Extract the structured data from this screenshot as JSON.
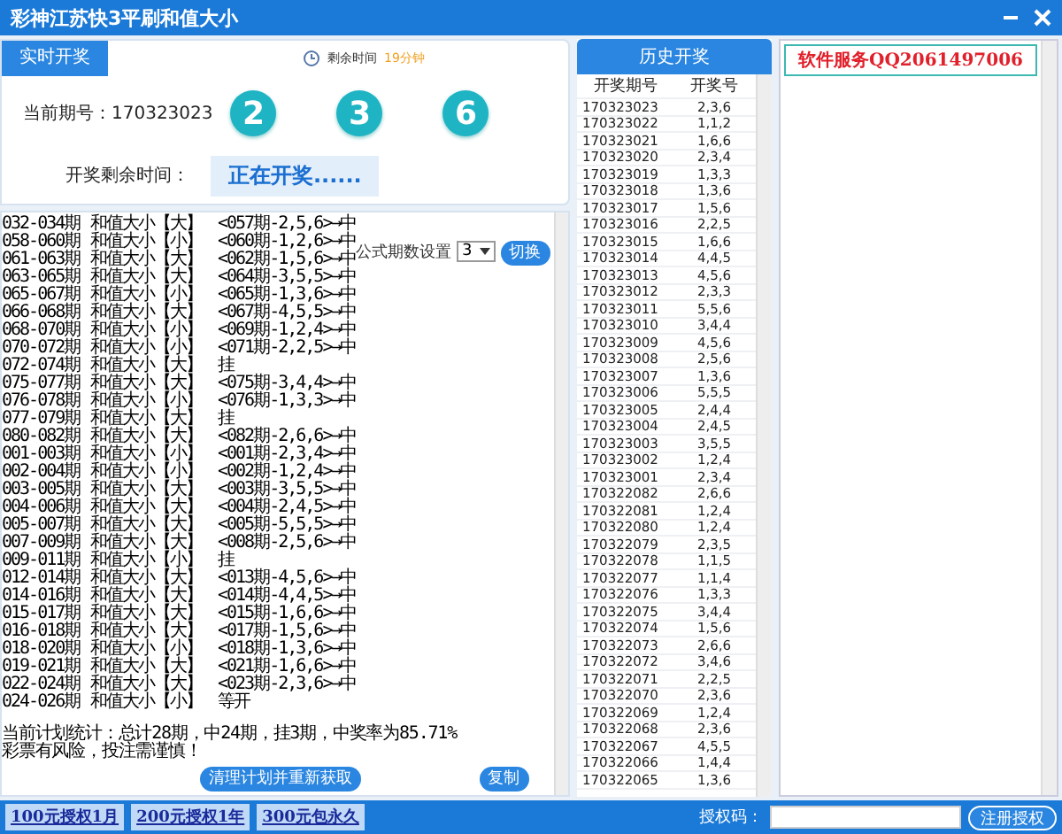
{
  "window": {
    "title": "彩神江苏快3平刷和值大小"
  },
  "live": {
    "tab": "实时开奖",
    "countdown_label": "剩余时间",
    "countdown_value": "19分钟",
    "period_label": "当前期号：",
    "period": "170323023",
    "balls": [
      "2",
      "3",
      "6"
    ],
    "remaining_label": "开奖剩余时间：",
    "status": "正在开奖......"
  },
  "plan": {
    "setting_label": "公式期数设置",
    "setting_value": "3",
    "switch_button": "切换",
    "log": [
      {
        "period": "032-034期",
        "plan": "和值大小【大】",
        "result": "<057期-2,5,6>→中"
      },
      {
        "period": "058-060期",
        "plan": "和值大小【小】",
        "result": "<060期-1,2,6>→中"
      },
      {
        "period": "061-063期",
        "plan": "和值大小【大】",
        "result": "<062期-1,5,6>→中"
      },
      {
        "period": "063-065期",
        "plan": "和值大小【大】",
        "result": "<064期-3,5,5>→中"
      },
      {
        "period": "065-067期",
        "plan": "和值大小【小】",
        "result": "<065期-1,3,6>→中"
      },
      {
        "period": "066-068期",
        "plan": "和值大小【大】",
        "result": "<067期-4,5,5>→中"
      },
      {
        "period": "068-070期",
        "plan": "和值大小【小】",
        "result": "<069期-1,2,4>→中"
      },
      {
        "period": "070-072期",
        "plan": "和值大小【小】",
        "result": "<071期-2,2,5>→中"
      },
      {
        "period": "072-074期",
        "plan": "和值大小【大】",
        "result": "挂"
      },
      {
        "period": "075-077期",
        "plan": "和值大小【大】",
        "result": "<075期-3,4,4>→中"
      },
      {
        "period": "076-078期",
        "plan": "和值大小【小】",
        "result": "<076期-1,3,3>→中"
      },
      {
        "period": "077-079期",
        "plan": "和值大小【大】",
        "result": "挂"
      },
      {
        "period": "080-082期",
        "plan": "和值大小【大】",
        "result": "<082期-2,6,6>→中"
      },
      {
        "period": "001-003期",
        "plan": "和值大小【小】",
        "result": "<001期-2,3,4>→中"
      },
      {
        "period": "002-004期",
        "plan": "和值大小【小】",
        "result": "<002期-1,2,4>→中"
      },
      {
        "period": "003-005期",
        "plan": "和值大小【大】",
        "result": "<003期-3,5,5>→中"
      },
      {
        "period": "004-006期",
        "plan": "和值大小【大】",
        "result": "<004期-2,4,5>→中"
      },
      {
        "period": "005-007期",
        "plan": "和值大小【大】",
        "result": "<005期-5,5,5>→中"
      },
      {
        "period": "007-009期",
        "plan": "和值大小【大】",
        "result": "<008期-2,5,6>→中"
      },
      {
        "period": "009-011期",
        "plan": "和值大小【小】",
        "result": "挂"
      },
      {
        "period": "012-014期",
        "plan": "和值大小【大】",
        "result": "<013期-4,5,6>→中"
      },
      {
        "period": "014-016期",
        "plan": "和值大小【大】",
        "result": "<014期-4,4,5>→中"
      },
      {
        "period": "015-017期",
        "plan": "和值大小【大】",
        "result": "<015期-1,6,6>→中"
      },
      {
        "period": "016-018期",
        "plan": "和值大小【大】",
        "result": "<017期-1,5,6>→中"
      },
      {
        "period": "018-020期",
        "plan": "和值大小【小】",
        "result": "<018期-1,3,6>→中"
      },
      {
        "period": "019-021期",
        "plan": "和值大小【大】",
        "result": "<021期-1,6,6>→中"
      },
      {
        "period": "022-024期",
        "plan": "和值大小【大】",
        "result": "<023期-2,3,6>→中"
      },
      {
        "period": "024-026期",
        "plan": "和值大小【小】",
        "result": "等开"
      }
    ],
    "stats": [
      "当前计划统计：总计28期，中24期，挂3期，中奖率为85.71%",
      "彩票有风险，投注需谨慎！"
    ],
    "buttons": [
      "清理计划并重新获取",
      "复制"
    ]
  },
  "history": {
    "title": "历史开奖",
    "columns": [
      "开奖期号",
      "开奖号"
    ],
    "rows": [
      [
        "170323023",
        "2,3,6"
      ],
      [
        "170323022",
        "1,1,2"
      ],
      [
        "170323021",
        "1,6,6"
      ],
      [
        "170323020",
        "2,3,4"
      ],
      [
        "170323019",
        "1,3,3"
      ],
      [
        "170323018",
        "1,3,6"
      ],
      [
        "170323017",
        "1,5,6"
      ],
      [
        "170323016",
        "2,2,5"
      ],
      [
        "170323015",
        "1,6,6"
      ],
      [
        "170323014",
        "4,4,5"
      ],
      [
        "170323013",
        "4,5,6"
      ],
      [
        "170323012",
        "2,3,3"
      ],
      [
        "170323011",
        "5,5,6"
      ],
      [
        "170323010",
        "3,4,4"
      ],
      [
        "170323009",
        "4,5,6"
      ],
      [
        "170323008",
        "2,5,6"
      ],
      [
        "170323007",
        "1,3,6"
      ],
      [
        "170323006",
        "5,5,5"
      ],
      [
        "170323005",
        "2,4,4"
      ],
      [
        "170323004",
        "2,4,5"
      ],
      [
        "170323003",
        "3,5,5"
      ],
      [
        "170323002",
        "1,2,4"
      ],
      [
        "170323001",
        "2,3,4"
      ],
      [
        "170322082",
        "2,6,6"
      ],
      [
        "170322081",
        "1,2,4"
      ],
      [
        "170322080",
        "1,2,4"
      ],
      [
        "170322079",
        "2,3,5"
      ],
      [
        "170322078",
        "1,1,5"
      ],
      [
        "170322077",
        "1,1,4"
      ],
      [
        "170322076",
        "1,3,3"
      ],
      [
        "170322075",
        "3,4,4"
      ],
      [
        "170322074",
        "1,5,6"
      ],
      [
        "170322073",
        "2,6,6"
      ],
      [
        "170322072",
        "3,4,6"
      ],
      [
        "170322071",
        "2,2,5"
      ],
      [
        "170322070",
        "2,3,6"
      ],
      [
        "170322069",
        "1,2,4"
      ],
      [
        "170322068",
        "2,3,6"
      ],
      [
        "170322067",
        "4,5,5"
      ],
      [
        "170322066",
        "1,4,4"
      ],
      [
        "170322065",
        "1,3,6"
      ]
    ]
  },
  "service": {
    "text": "软件服务QQ2061497006"
  },
  "footer": {
    "links": [
      "100元授权1月",
      "200元授权1年",
      "300元包永久"
    ],
    "code_label": "授权码：",
    "register_button": "注册授权"
  }
}
